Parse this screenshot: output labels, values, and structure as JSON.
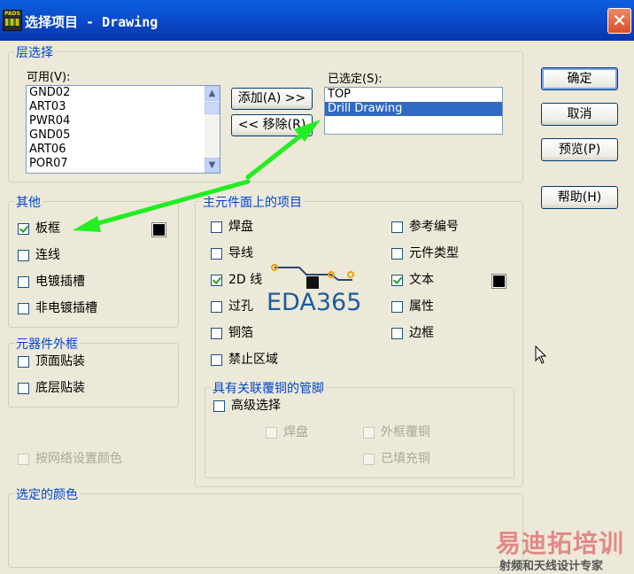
{
  "window": {
    "title": "选择项目 - Drawing",
    "close_glyph": "✕",
    "app_icon_text": "PADS"
  },
  "layer_selection": {
    "legend": "层选择",
    "available_label": "可用(V):",
    "available_items": [
      "GND02",
      "ART03",
      "PWR04",
      "GND05",
      "ART06",
      "POR07"
    ],
    "add_button": "添加(A) >>",
    "remove_button": "<< 移除(R)",
    "selected_label": "已选定(S):",
    "selected_items": [
      "TOP",
      "Drill Drawing"
    ],
    "selected_highlight": "Drill Drawing"
  },
  "buttons": {
    "ok": "确定",
    "cancel": "取消",
    "preview": "预览(P)",
    "help": "帮助(H)"
  },
  "other": {
    "legend": "其他",
    "board_outline": "板框",
    "connections": "连线",
    "plated_slots": "电镀插槽",
    "non_plated_slots": "非电镀插槽"
  },
  "component_outline": {
    "legend": "元器件外框",
    "top_mount": "顶面贴装",
    "bottom_mount": "底层贴装"
  },
  "net_color": "按网络设置颜色",
  "primary_items": {
    "legend": "主元件面上的项目",
    "pads": "焊盘",
    "traces": "导线",
    "lines_2d": "2D 线",
    "vias": "过孔",
    "copper": "铜箔",
    "keepout": "禁止区域",
    "ref_des": "参考编号",
    "part_type": "元件类型",
    "text": "文本",
    "attributes": "属性",
    "outline": "边框"
  },
  "copper_pins": {
    "legend": "具有关联覆铜的管脚",
    "advanced": "高级选择",
    "pads": "焊盘",
    "outline_copper": "外框覆铜",
    "filled_copper": "已填充铜"
  },
  "selected_color": {
    "legend": "选定的颜色"
  },
  "logo_text": "EDA365",
  "watermark": {
    "line1": "易迪拓培训",
    "line2": "射频和天线设计专家"
  },
  "colors": {
    "title_blue": "#0a48c8",
    "accent_green": "#22ee22",
    "legend_blue": "#0046d5",
    "selection": "#316ac5"
  },
  "icons": {
    "close": "close-icon",
    "cursor": "mouse-pointer-icon",
    "arrow": "green-arrow-annotation"
  }
}
